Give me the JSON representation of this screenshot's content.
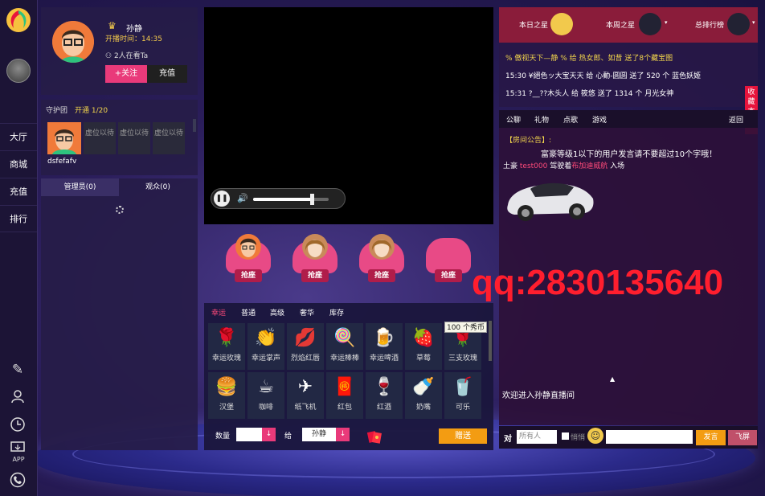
{
  "nav": {
    "items": [
      "大厅",
      "商城",
      "充值",
      "排行"
    ],
    "app_label": "APP"
  },
  "host": {
    "name": "孙静",
    "time_label": "开播时间：14:35",
    "watching": "2人在看Ta",
    "follow_label": "+关注",
    "charge_label": "充值"
  },
  "guard": {
    "title": "守护团",
    "open": "开通 1/20",
    "user": "dsfefafv",
    "slot_label": "虚位以待"
  },
  "members": {
    "tab_admin": "管理员(0)",
    "tab_audience": "观众(0)"
  },
  "video": {
    "volume_fraction": 0.78
  },
  "seats": {
    "label": "抢座"
  },
  "gifts": {
    "tabs": [
      "幸运",
      "普通",
      "高级",
      "奢华",
      "库存"
    ],
    "row1": [
      {
        "label": "幸运玫瑰",
        "icon": "rose-icon",
        "glyph": "🌹"
      },
      {
        "label": "幸运掌声",
        "icon": "clap-icon",
        "glyph": "👏"
      },
      {
        "label": "烈焰红唇",
        "icon": "lips-icon",
        "glyph": "💋"
      },
      {
        "label": "幸运棒棒",
        "icon": "lollipop-icon",
        "glyph": "🍭"
      },
      {
        "label": "幸运啤酒",
        "icon": "beer-icon",
        "glyph": "🍺"
      },
      {
        "label": "草莓",
        "icon": "strawberry-icon",
        "glyph": "🍓"
      },
      {
        "label": "三支玫瑰",
        "icon": "roses-icon",
        "glyph": "🌹"
      }
    ],
    "row2": [
      {
        "label": "汉堡",
        "icon": "burger-icon",
        "glyph": "🍔"
      },
      {
        "label": "咖啡",
        "icon": "coffee-icon",
        "glyph": "☕"
      },
      {
        "label": "纸飞机",
        "icon": "paper-plane-icon",
        "glyph": "✈"
      },
      {
        "label": "红包",
        "icon": "red-envelope-icon",
        "glyph": "🧧"
      },
      {
        "label": "红酒",
        "icon": "wine-icon",
        "glyph": "🍷"
      },
      {
        "label": "奶嘴",
        "icon": "pacifier-icon",
        "glyph": "🍼"
      },
      {
        "label": "可乐",
        "icon": "cola-icon",
        "glyph": "🥤"
      }
    ],
    "tooltip": "100 个秀币",
    "qty_label": "数量",
    "to_label": "给",
    "to_value": "孙静",
    "give_label": "赠送"
  },
  "stars": {
    "today": "本日之星",
    "week": "本周之星",
    "total": "总排行榜"
  },
  "ranking": [
    "% 傲视天下—静 % 给 热女郎、如昔 送了8个藏宝图",
    "15:30 ¥絕色ッ大宝天天 给 心動-圆圆 送了 520 个 蓝色妖姬",
    "15:31 ?__??木头人 给 筱悠 送了 1314 个 月光女神"
  ],
  "collect": "收藏本页",
  "chat": {
    "tabs": [
      "公聊",
      "礼物",
      "点歌",
      "游戏"
    ],
    "back": "返回",
    "notice_title": "【房间公告】:",
    "notice_text": "富豪等级1以下的用户发言请不要超过10个字哦！",
    "enter_rank": "土豪",
    "enter_user": "test000",
    "enter_mid": "驾驶着",
    "enter_car": "布加迪威航",
    "enter_tail": "入场",
    "welcome": "欢迎进入孙静直播间",
    "to": "对",
    "all": "所有人",
    "whisper": "悄悄",
    "send": "发言",
    "fly": "飞屏"
  },
  "watermark": "qq:2830135640",
  "colors": {
    "accent": "#e93a7a",
    "gold": "#f2d54c",
    "orange": "#f39c12"
  }
}
